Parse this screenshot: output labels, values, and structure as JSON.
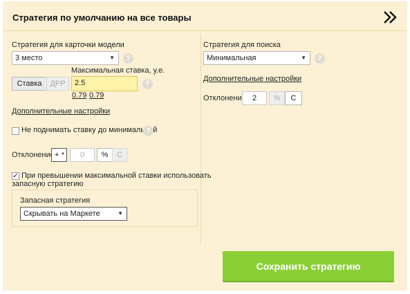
{
  "panel": {
    "title": "Стратегия по умолчанию на все товары",
    "collapse_icon": "double-chevron-right-icon"
  },
  "left": {
    "card_strategy": {
      "label": "Стратегия для карточки модели",
      "selected": "3 место"
    },
    "bid_toggle": {
      "stavka": "Ставка",
      "drr": "ДРР"
    },
    "max_bid": {
      "label": "Максимальная ставка, у.е.",
      "value": "2.5",
      "hint_1": "0.79",
      "hint_2": "0.79"
    },
    "advanced_link": "Дополнительные настройки",
    "no_raise": {
      "label": "Не поднимать ставку до минимальной",
      "checked": false
    },
    "deviation": {
      "label": "Отклонение",
      "sign": "+",
      "value": "0",
      "percent": "%",
      "currency": "С"
    },
    "fallback_check": {
      "label_line1": "При превышении максимальной ставки использовать",
      "label_line2": "запасную стратегию",
      "checked": true,
      "check_mark": "✓"
    },
    "fallback": {
      "label": "Запасная стратегия",
      "selected": "Скрывать на Маркете"
    }
  },
  "right": {
    "search_strategy": {
      "label": "Стратегия для поиска",
      "selected": "Минимальная"
    },
    "advanced_link": "Дополнительные настройки",
    "deviation": {
      "label": "Отклонение",
      "value": "2",
      "percent": "%",
      "currency": "С"
    }
  },
  "save_button": "Сохранить стратегию",
  "help_glyph": "?",
  "caret_glyph": "▼",
  "colors": {
    "panel_bg": "#fcf1d4",
    "save_green": "#8bcf36",
    "highlight_input": "#fdf3a9"
  }
}
